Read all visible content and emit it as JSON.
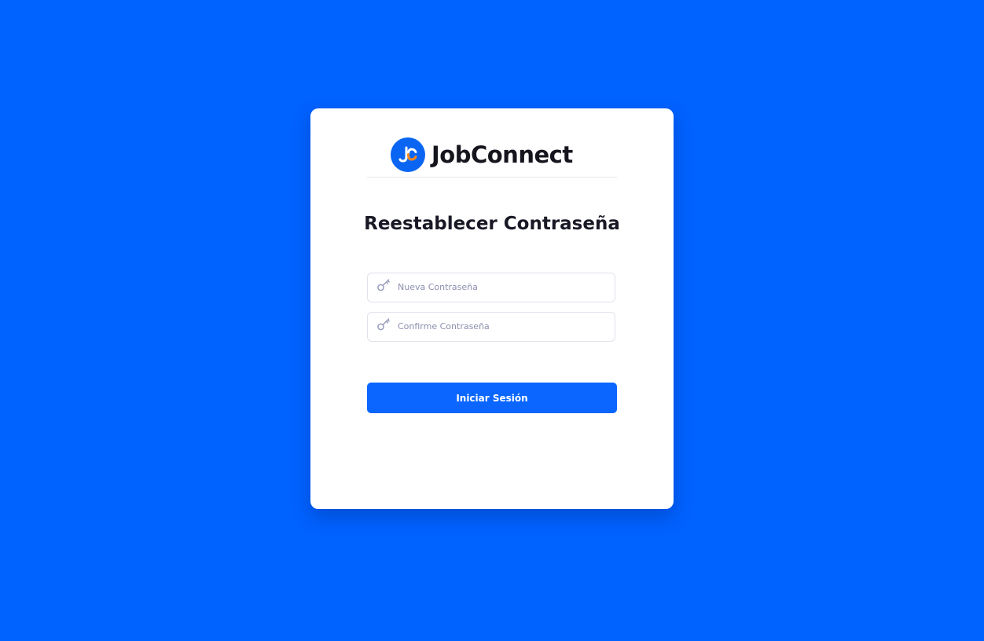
{
  "brand": {
    "name": "JobConnect",
    "logo_icon": "jc-monogram-logo",
    "logo_color": "#0a66f2",
    "accent_color": "#ff8a1e"
  },
  "page": {
    "title": "Reestablecer Contraseña",
    "background_color": "#0062ff"
  },
  "form": {
    "new_password": {
      "icon": "key-icon",
      "placeholder": "Nueva Contraseña",
      "value": ""
    },
    "confirm_password": {
      "icon": "key-icon",
      "placeholder": "Confirme Contraseña",
      "value": ""
    },
    "submit_label": "Iniciar Sesión",
    "submit_color": "#0a66ff"
  }
}
